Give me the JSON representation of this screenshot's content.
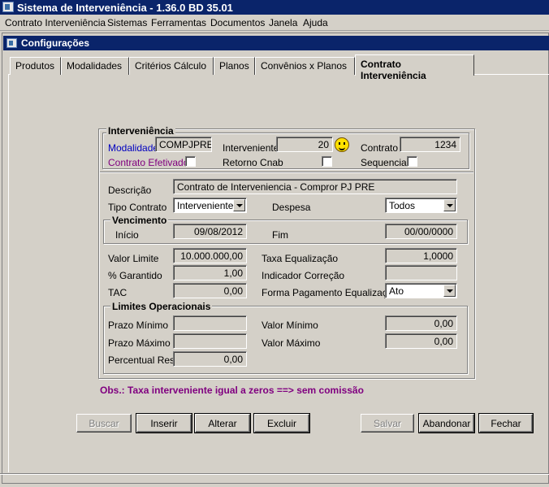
{
  "window": {
    "title": "Sistema de Interveniência - 1.36.0 BD 35.01"
  },
  "menu": [
    "Contrato Interveniência",
    "Sistemas",
    "Ferramentas",
    "Documentos",
    "Janela",
    "Ajuda"
  ],
  "inner_window": {
    "title": "Configurações"
  },
  "tabs": [
    "Produtos",
    "Modalidades",
    "Critérios Cálculo",
    "Planos",
    "Convênios x Planos",
    "Contrato Interveniência"
  ],
  "active_tab": "Contrato Interveniência",
  "interveniencia": {
    "group_title": "Interveniência",
    "modalidade_label": "Modalidade",
    "modalidade_value": "COMPJPRE",
    "interveniente_label": "Interveniente",
    "interveniente_value": "20",
    "contrato_label": "Contrato",
    "contrato_value": "1234",
    "contrato_efetivado_label": "Contrato Efetivado",
    "retorno_cnab_label": "Retorno Cnab",
    "sequencial_label": "Sequencial"
  },
  "details": {
    "descricao_label": "Descrição",
    "descricao_value": "Contrato de Interveniencia - Compror PJ PRE",
    "tipo_contrato_label": "Tipo Contrato",
    "tipo_contrato_value": "Interveniente",
    "despesa_label": "Despesa",
    "despesa_value": "Todos"
  },
  "vencimento": {
    "group_title": "Vencimento",
    "inicio_label": "Início",
    "inicio_value": "09/08/2012",
    "fim_label": "Fim",
    "fim_value": "00/00/0000"
  },
  "valores": {
    "valor_limite_label": "Valor Limite",
    "valor_limite_value": "10.000.000,00",
    "garantido_label": "% Garantido",
    "garantido_value": "1,00",
    "tac_label": "TAC",
    "tac_value": "0,00",
    "taxa_equalizacao_label": "Taxa Equalização",
    "taxa_equalizacao_value": "1,0000",
    "indicador_correcao_label": "Indicador Correção",
    "indicador_correcao_value": "",
    "forma_pagamento_label": "Forma Pagamento Equalização",
    "forma_pagamento_value": "Ato"
  },
  "limites": {
    "group_title": "Limites Operacionais",
    "prazo_minimo_label": "Prazo Mínimo",
    "prazo_minimo_value": "",
    "prazo_maximo_label": "Prazo Máximo",
    "prazo_maximo_value": "",
    "percentual_resp_label": "Percentual Resp",
    "percentual_resp_value": "0,00",
    "valor_minimo_label": "Valor Mínimo",
    "valor_minimo_value": "0,00",
    "valor_maximo_label": "Valor Máximo",
    "valor_maximo_value": "0,00"
  },
  "obs": "Obs.: Taxa interveniente igual a zeros ==> sem comissão",
  "buttons": {
    "buscar": "Buscar",
    "inserir": "Inserir",
    "alterar": "Alterar",
    "excluir": "Excluir",
    "salvar": "Salvar",
    "abandonar": "Abandonar",
    "fechar": "Fechar"
  },
  "colors": {
    "title_bar": "#0a246a",
    "face": "#d4d0c8",
    "modalidade_label": "#0000c0",
    "obs_text": "#800080"
  }
}
